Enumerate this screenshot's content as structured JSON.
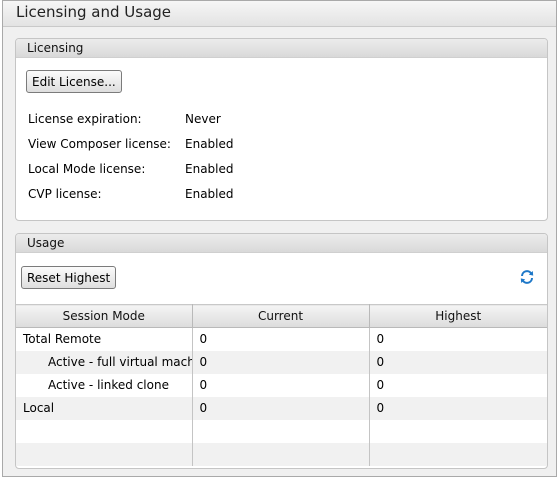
{
  "window": {
    "title": "Licensing and Usage"
  },
  "licensing": {
    "header": "Licensing",
    "edit_button": "Edit License...",
    "rows": [
      {
        "label": "License expiration:",
        "value": "Never"
      },
      {
        "label": "View Composer license:",
        "value": "Enabled"
      },
      {
        "label": "Local Mode license:",
        "value": "Enabled"
      },
      {
        "label": "CVP license:",
        "value": "Enabled"
      }
    ]
  },
  "usage": {
    "header": "Usage",
    "reset_button": "Reset Highest",
    "refresh_icon": "refresh-icon",
    "columns": [
      "Session Mode",
      "Current",
      "Highest"
    ],
    "rows": [
      {
        "mode": "Total Remote",
        "current": "0",
        "highest": "0"
      },
      {
        "mode": "Active - full virtual machi",
        "current": "0",
        "highest": "0"
      },
      {
        "mode": "Active - linked clone",
        "current": "0",
        "highest": "0"
      },
      {
        "mode": "Local",
        "current": "0",
        "highest": "0"
      }
    ]
  },
  "colors": {
    "accent_refresh": "#1e78c8",
    "panel_header": "#dedede"
  }
}
